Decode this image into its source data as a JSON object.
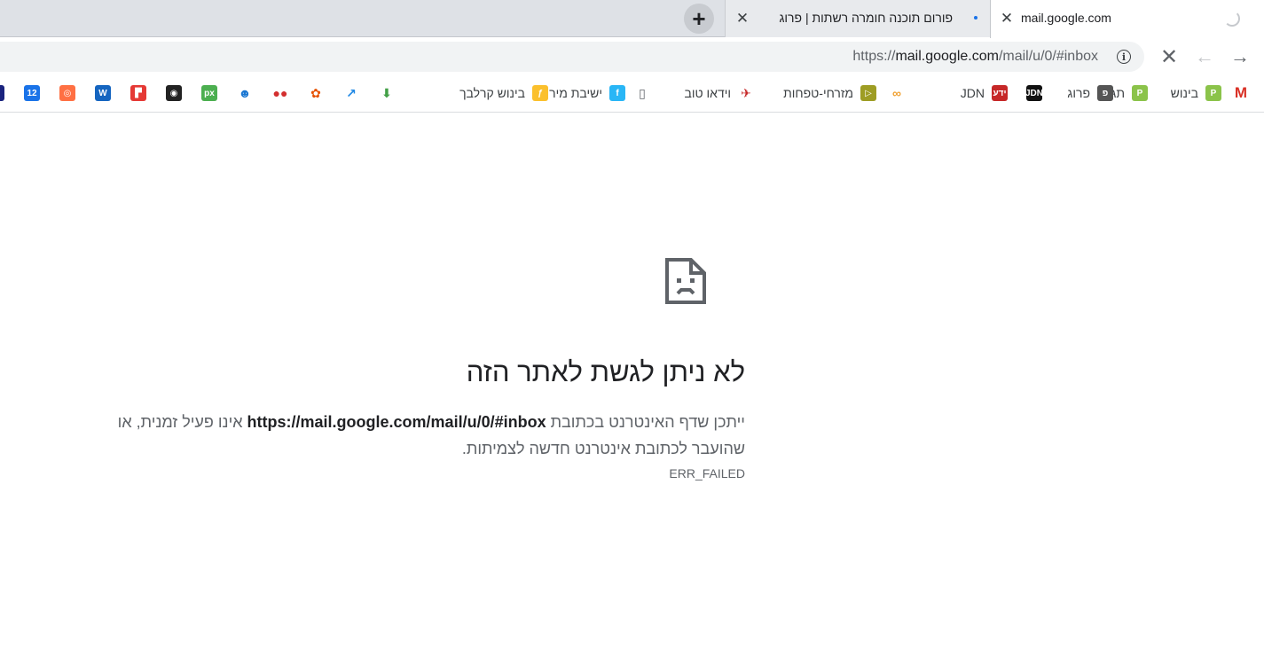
{
  "tabs": [
    {
      "title": "mail.google.com",
      "active": true,
      "loading": true
    },
    {
      "title": "פורום תוכנה חומרה רשתות | פרוג",
      "active": false,
      "has_notification_dot": true
    }
  ],
  "newtab": {
    "icon": "plus-icon"
  },
  "toolbar": {
    "url_prefix": "https://",
    "url_host": "mail.google.com",
    "url_path": "/mail/u/0/#inbox",
    "info_icon_glyph": "i"
  },
  "bookmarks": [
    {
      "label": "",
      "icon": "gmail-icon",
      "color": "#d93025",
      "glyph": "M"
    },
    {
      "label": "בינוש",
      "icon": "proj-icon",
      "color": "#8bc34a",
      "glyph": "P"
    },
    {
      "label": "תג",
      "icon": "proj-icon",
      "color": "#8bc34a",
      "glyph": "P"
    },
    {
      "label": "פרוג",
      "icon": "prog-icon",
      "color": "#555555",
      "glyph": "פ"
    },
    {
      "label": "",
      "icon": "jdn-icon",
      "color": "#111111",
      "glyph": "JDN"
    },
    {
      "label": "JDN",
      "icon": "yediot-icon",
      "color": "#c62828",
      "glyph": "ידע"
    },
    {
      "label": "",
      "icon": "infinity-icon",
      "color": "#f0a030",
      "glyph": "∞"
    },
    {
      "label": "מזרחי-טפחות",
      "icon": "video-icon",
      "color": "#9e9d24",
      "glyph": "▷"
    },
    {
      "label": "וידאו טוב",
      "icon": "flag-icon",
      "color": "#c62828",
      "glyph": "✈"
    },
    {
      "label": "",
      "icon": "document-icon",
      "color": "#5f6368",
      "glyph": "▯"
    },
    {
      "label": "ישיבת מיר",
      "icon": "freelance-icon",
      "color": "#29b6f6",
      "glyph": "f"
    },
    {
      "label": "בינוש קרלבך",
      "icon": "yellow-figure-icon",
      "color": "#fbc02d",
      "glyph": "ƒ"
    },
    {
      "label": "",
      "icon": "download-arrow-icon",
      "color": "#43a047",
      "glyph": "⬇"
    },
    {
      "label": "",
      "icon": "trend-icon",
      "color": "#1e88e5",
      "glyph": "↗"
    },
    {
      "label": "",
      "icon": "flower-icon",
      "color": "#e65100",
      "glyph": "✿"
    },
    {
      "label": "",
      "icon": "dots-icon",
      "color": "#d32f2f",
      "glyph": "●●"
    },
    {
      "label": "",
      "icon": "robot-icon",
      "color": "#1976d2",
      "glyph": "☻"
    },
    {
      "label": "",
      "icon": "px-icon",
      "color": "#4caf50",
      "glyph": "px"
    },
    {
      "label": "",
      "icon": "camera-icon",
      "color": "#222222",
      "glyph": "◉"
    },
    {
      "label": "",
      "icon": "red-square-icon",
      "color": "#e53935",
      "glyph": "▛"
    },
    {
      "label": "",
      "icon": "word-icon",
      "color": "#1565c0",
      "glyph": "W"
    },
    {
      "label": "",
      "icon": "circle-logo-icon",
      "color": "#ff7043",
      "glyph": "◎"
    },
    {
      "label": "",
      "icon": "calendar-icon",
      "color": "#1a73e8",
      "glyph": "12"
    },
    {
      "label": "",
      "icon": "partial-icon",
      "color": "#1a237e",
      "glyph": ""
    }
  ],
  "error": {
    "title": "לא ניתן לגשת לאתר הזה",
    "desc_before": "ייתכן שדף האינטרנט בכתובת ",
    "desc_url": "https://mail.google.com/mail/u/0/#inbox",
    "desc_after": " אינו פעיל זמנית, או שהועבר לכתובת אינטרנט חדשה לצמיתות.",
    "code": "ERR_FAILED"
  }
}
